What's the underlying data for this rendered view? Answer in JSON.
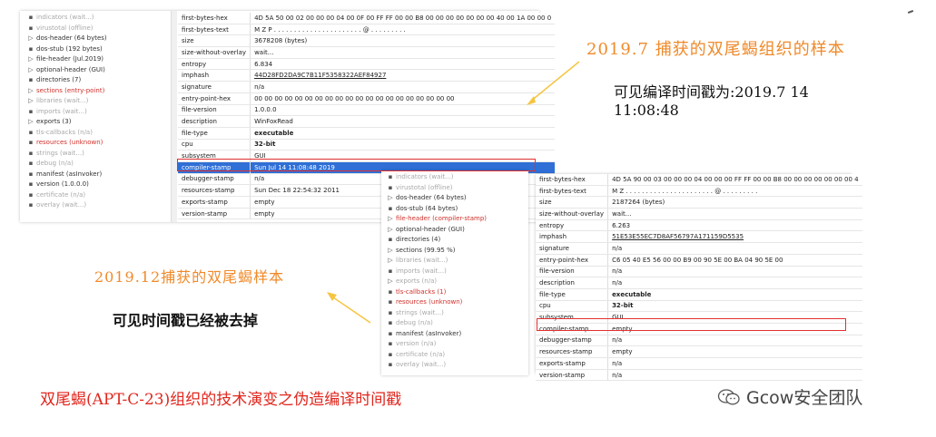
{
  "panel1": {
    "tree": [
      {
        "icon": "ini-icon",
        "label": "indicators (wait...)",
        "style": "grey"
      },
      {
        "icon": "virustotal-icon",
        "label": "virustotal (offline)",
        "style": "grey"
      },
      {
        "icon": "arrow-icon",
        "label": "dos-header (64 bytes)",
        "style": "normal"
      },
      {
        "icon": "dos-icon",
        "label": "dos-stub (192 bytes)",
        "style": "normal"
      },
      {
        "icon": "arrow-icon",
        "label": "file-header (Jul.2019)",
        "style": "normal"
      },
      {
        "icon": "arrow-icon",
        "label": "optional-header (GUI)",
        "style": "normal"
      },
      {
        "icon": "directories-icon",
        "label": "directories (7)",
        "style": "normal"
      },
      {
        "icon": "arrow-icon",
        "label": "sections (entry-point)",
        "style": "red"
      },
      {
        "icon": "arrow-icon",
        "label": "libraries (wait...)",
        "style": "grey"
      },
      {
        "icon": "imports-icon",
        "label": "imports (wait...)",
        "style": "grey"
      },
      {
        "icon": "arrow-icon",
        "label": "exports (3)",
        "style": "normal"
      },
      {
        "icon": "tls-icon",
        "label": "tls-callbacks (n/a)",
        "style": "grey"
      },
      {
        "icon": "resources-icon",
        "label": "resources (unknown)",
        "style": "red"
      },
      {
        "icon": "abc-icon",
        "label": "strings (wait...)",
        "style": "grey"
      },
      {
        "icon": "debug-icon",
        "label": "debug (n/a)",
        "style": "grey"
      },
      {
        "icon": "manifest-icon",
        "label": "manifest (asInvoker)",
        "style": "normal"
      },
      {
        "icon": "version-icon",
        "label": "version (1.0.0.0)",
        "style": "normal"
      },
      {
        "icon": "certificate-icon",
        "label": "certificate (n/a)",
        "style": "grey"
      },
      {
        "icon": "overlay-icon",
        "label": "overlay (wait...)",
        "style": "grey"
      }
    ],
    "table": [
      {
        "k": "first-bytes-hex",
        "v": "4D 5A 50 00 02 00 00 00 04 00 0F 00 FF FF 00 00 B8 00 00 00 00 00 00 00 40 00 1A 00 00 0",
        "s": ""
      },
      {
        "k": "first-bytes-text",
        "v": "M Z P . . . . . . . . . . . . . . . . . . . . . . @ . . . . . . . . .",
        "s": ""
      },
      {
        "k": "size",
        "v": "3678208 (bytes)",
        "s": ""
      },
      {
        "k": "size-without-overlay",
        "v": "wait...",
        "s": "grey"
      },
      {
        "k": "entropy",
        "v": "6.834",
        "s": ""
      },
      {
        "k": "imphash",
        "v": "44D28FD2DA9C7B11F5358322AEF84927",
        "s": "blue"
      },
      {
        "k": "signature",
        "v": "n/a",
        "s": "grey"
      },
      {
        "k": "entry-point-hex",
        "v": "00 00 00 00 00 00 00 00 00 00 00 00 00 00 00 00 00 00 00 00",
        "s": ""
      },
      {
        "k": "file-version",
        "v": "1.0.0.0",
        "s": ""
      },
      {
        "k": "description",
        "v": "WinFoxRead",
        "s": ""
      },
      {
        "k": "file-type",
        "v": "executable",
        "s": "bold"
      },
      {
        "k": "cpu",
        "v": "32-bit",
        "s": "bblue"
      },
      {
        "k": "subsystem",
        "v": "GUI",
        "s": ""
      },
      {
        "k": "compiler-stamp",
        "v": "Sun Jul 14 11:08:48 2019",
        "s": "sel"
      },
      {
        "k": "debugger-stamp",
        "v": "n/a",
        "s": "grey"
      },
      {
        "k": "resources-stamp",
        "v": "Sun Dec 18 22:54:32 2011",
        "s": ""
      },
      {
        "k": "exports-stamp",
        "v": "empty",
        "s": "grey"
      },
      {
        "k": "version-stamp",
        "v": "empty",
        "s": "grey"
      }
    ]
  },
  "panel2": {
    "tree": [
      {
        "icon": "ini-icon",
        "label": "indicators (wait...)",
        "style": "grey"
      },
      {
        "icon": "virustotal-icon",
        "label": "virustotal (offline)",
        "style": "grey"
      },
      {
        "icon": "arrow-icon",
        "label": "dos-header (64 bytes)",
        "style": "normal"
      },
      {
        "icon": "dos-icon",
        "label": "dos-stub (64 bytes)",
        "style": "normal"
      },
      {
        "icon": "arrow-icon",
        "label": "file-header (compiler-stamp)",
        "style": "red"
      },
      {
        "icon": "arrow-icon",
        "label": "optional-header (GUI)",
        "style": "normal"
      },
      {
        "icon": "directories-icon",
        "label": "directories (4)",
        "style": "normal"
      },
      {
        "icon": "arrow-icon",
        "label": "sections (99.95 %)",
        "style": "normal"
      },
      {
        "icon": "arrow-icon",
        "label": "libraries (wait...)",
        "style": "grey"
      },
      {
        "icon": "imports-icon",
        "label": "imports (wait...)",
        "style": "grey"
      },
      {
        "icon": "arrow-icon",
        "label": "exports (n/a)",
        "style": "grey"
      },
      {
        "icon": "tls-icon",
        "label": "tls-callbacks (1)",
        "style": "red"
      },
      {
        "icon": "resources-icon",
        "label": "resources (unknown)",
        "style": "red"
      },
      {
        "icon": "abc-icon",
        "label": "strings (wait...)",
        "style": "grey"
      },
      {
        "icon": "debug-icon",
        "label": "debug (n/a)",
        "style": "grey"
      },
      {
        "icon": "manifest-icon",
        "label": "manifest (asInvoker)",
        "style": "normal"
      },
      {
        "icon": "version-icon",
        "label": "version (n/a)",
        "style": "grey"
      },
      {
        "icon": "certificate-icon",
        "label": "certificate (n/a)",
        "style": "grey"
      },
      {
        "icon": "overlay-icon",
        "label": "overlay (wait...)",
        "style": "grey"
      }
    ],
    "table": [
      {
        "k": "first-bytes-hex",
        "v": "4D 5A 90 00 03 00 00 00 04 00 00 00 FF FF 00 00 B8 00 00 00 00 00 00 00 4",
        "s": ""
      },
      {
        "k": "first-bytes-text",
        "v": "M Z . . . . . . . . . . . . . . . . . . . . . . @ . . . . . . . . .",
        "s": ""
      },
      {
        "k": "size",
        "v": "2187264 (bytes)",
        "s": ""
      },
      {
        "k": "size-without-overlay",
        "v": "wait...",
        "s": "grey"
      },
      {
        "k": "entropy",
        "v": "6.263",
        "s": ""
      },
      {
        "k": "imphash",
        "v": "51E53E55EC7D8AF56797A171159D5535",
        "s": "blue"
      },
      {
        "k": "signature",
        "v": "n/a",
        "s": "grey"
      },
      {
        "k": "entry-point-hex",
        "v": "C6 05 40 E5 56 00 00 B9 00 90 5E 00 BA 04 90 5E 00",
        "s": ""
      },
      {
        "k": "file-version",
        "v": "n/a",
        "s": "grey"
      },
      {
        "k": "description",
        "v": "n/a",
        "s": "grey"
      },
      {
        "k": "file-type",
        "v": "executable",
        "s": "bold"
      },
      {
        "k": "cpu",
        "v": "32-bit",
        "s": "bblue"
      },
      {
        "k": "subsystem",
        "v": "GUI",
        "s": ""
      },
      {
        "k": "compiler-stamp",
        "v": "empty",
        "s": "red"
      },
      {
        "k": "debugger-stamp",
        "v": "n/a",
        "s": "grey"
      },
      {
        "k": "resources-stamp",
        "v": "empty",
        "s": "grey"
      },
      {
        "k": "exports-stamp",
        "v": "n/a",
        "s": "grey"
      },
      {
        "k": "version-stamp",
        "v": "n/a",
        "s": "grey"
      }
    ]
  },
  "annotations": {
    "jul_title": "2019.7 捕获的双尾蝎组织的样本",
    "jul_desc_line1": "可见编译时间戳为:2019.7 14",
    "jul_desc_line2": "11:08:48",
    "dec_title": "2019.12捕获的双尾蝎样本",
    "dec_desc": "可见时间戳已经被去掉",
    "caption": "双尾蝎(APT-C-23)组织的技术演变之伪造编译时间戳",
    "watermark": "Gcow安全团队"
  },
  "colors": {
    "orange": "#f08a2a",
    "red": "#e0261d",
    "selection": "#2f6fd6",
    "arrow": "#f5c542"
  }
}
